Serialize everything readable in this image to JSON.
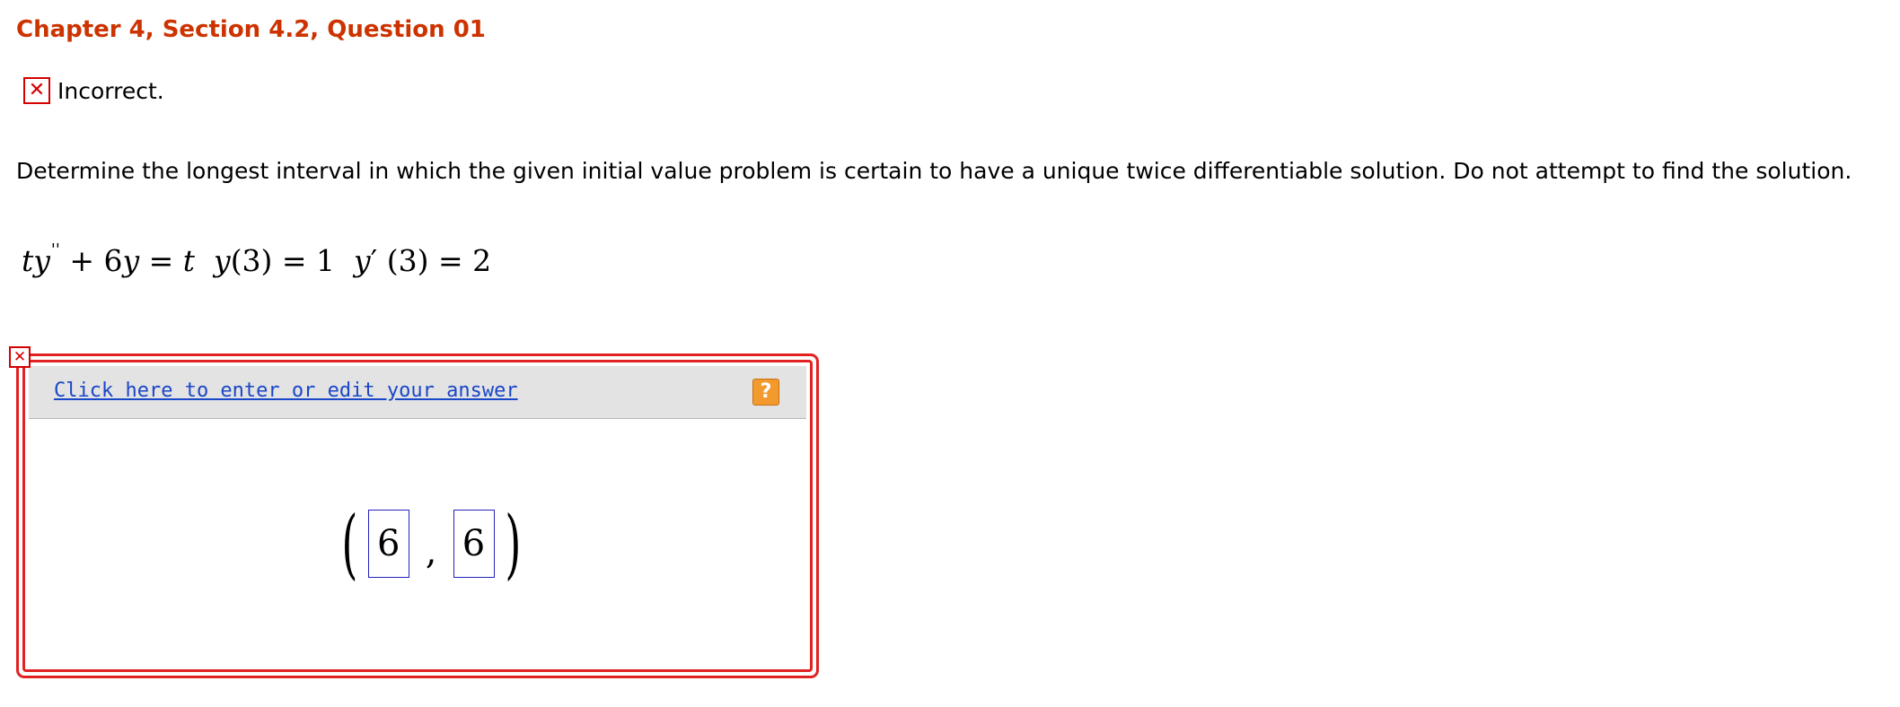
{
  "header": {
    "title": "Chapter 4, Section 4.2, Question 01"
  },
  "status": {
    "icon": "close-icon",
    "text": "Incorrect."
  },
  "question": {
    "text": "Determine the longest interval in which the given initial value problem is certain to have a unique twice differentiable solution. Do not attempt to find the solution."
  },
  "equation": {
    "t": "t",
    "y": "y",
    "double_prime": "''",
    "plus_6y": "+ 6",
    "y2": "y",
    "eq1": "=",
    "rhs_t": "t",
    "ic1_y": "y",
    "ic1_rest": "(3) = 1",
    "ic2_y": "y",
    "prime": "′",
    "ic2_rest": "(3) = 2"
  },
  "answer_panel": {
    "edit_link": "Click here to enter or edit your answer",
    "help_label": "?",
    "interval_left": "6",
    "separator": ",",
    "interval_right": "6",
    "open_paren": "(",
    "close_paren": ")"
  },
  "colors": {
    "title": "#cc3300",
    "error": "#d40000",
    "link": "#1a46c8",
    "help": "#f39a2e"
  }
}
